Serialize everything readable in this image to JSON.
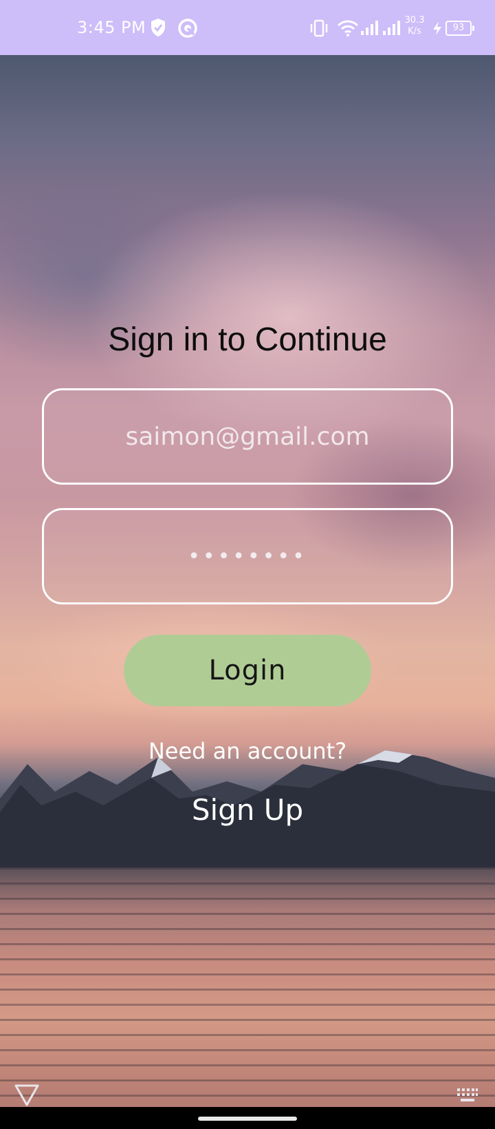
{
  "status_bar": {
    "time": "3:45 PM",
    "speed_value": "30.3",
    "speed_unit": "K/s",
    "battery": "93",
    "background": "#cdbdf9"
  },
  "icons": {
    "shield": "shield-icon",
    "vpn": "vpn-icon",
    "vibrate": "vibrate-icon",
    "wifi": "wifi-icon",
    "signal": "signal-icon",
    "charging": "bolt-icon",
    "back": "back-triangle-icon",
    "keyboard": "keyboard-icon"
  },
  "form": {
    "title": "Sign in to Continue",
    "email_value": "saimon@gmail.com",
    "password_mask": "••••••••",
    "login_label": "Login",
    "need_account": "Need an account?",
    "signup_label": "Sign Up"
  },
  "colors": {
    "login_button": "#b0cc95",
    "field_border": "#ffffff"
  }
}
